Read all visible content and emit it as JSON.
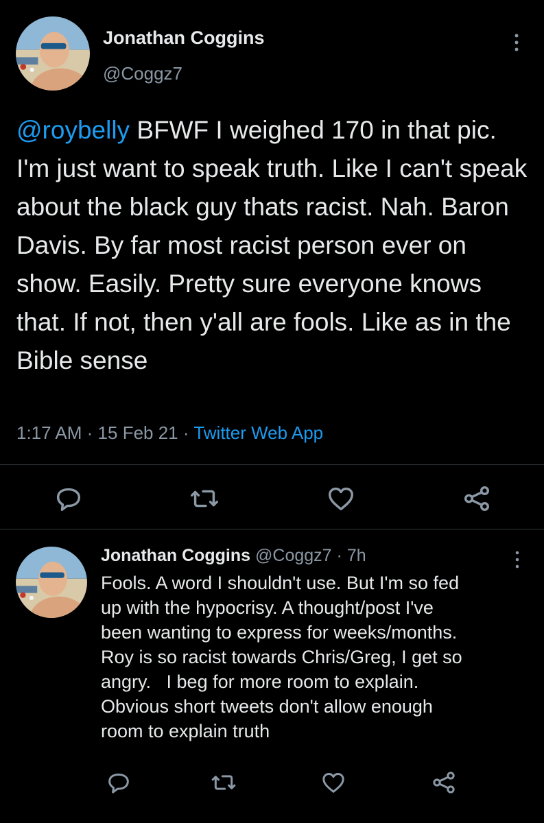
{
  "main_tweet": {
    "author_name": "Jonathan Coggins",
    "author_handle": "@Coggz7",
    "avatar_icon": "avatar-beach-photo",
    "mention": "@roybelly",
    "text": " BFWF I weighed 170 in that pic. I'm just want to speak truth. Like I can't speak about the black guy thats racist. Nah. Baron Davis. By far most racist person ever on show. Easily. Pretty sure everyone knows that. If not, then y'all are fools. Like as in the Bible sense",
    "time": "1:17 AM",
    "separator": "·",
    "date": "15 Feb 21",
    "source": "Twitter Web App",
    "actions": [
      "reply-icon",
      "retweet-icon",
      "like-icon",
      "share-icon"
    ]
  },
  "reply_tweet": {
    "author_name": "Jonathan Coggins",
    "author_handle": "@Coggz7",
    "separator": "·",
    "time": "7h",
    "avatar_icon": "avatar-beach-photo",
    "text": "Fools. A word I shouldn't use. But I'm so fed\nup with the hypocrisy. A thought/post I've\nbeen wanting to express for weeks/months.\nRoy is so racist towards Chris/Greg, I get so\nangry.   I beg for more room to explain.\nObvious short tweets don't allow enough\nroom to explain truth",
    "actions": [
      "reply-icon",
      "retweet-icon",
      "like-icon",
      "share-icon"
    ]
  },
  "colors": {
    "background": "#000000",
    "text": "#e7e9ea",
    "secondary": "#8b98a5",
    "accent": "#1d9bf0",
    "divider": "#2f3336"
  }
}
